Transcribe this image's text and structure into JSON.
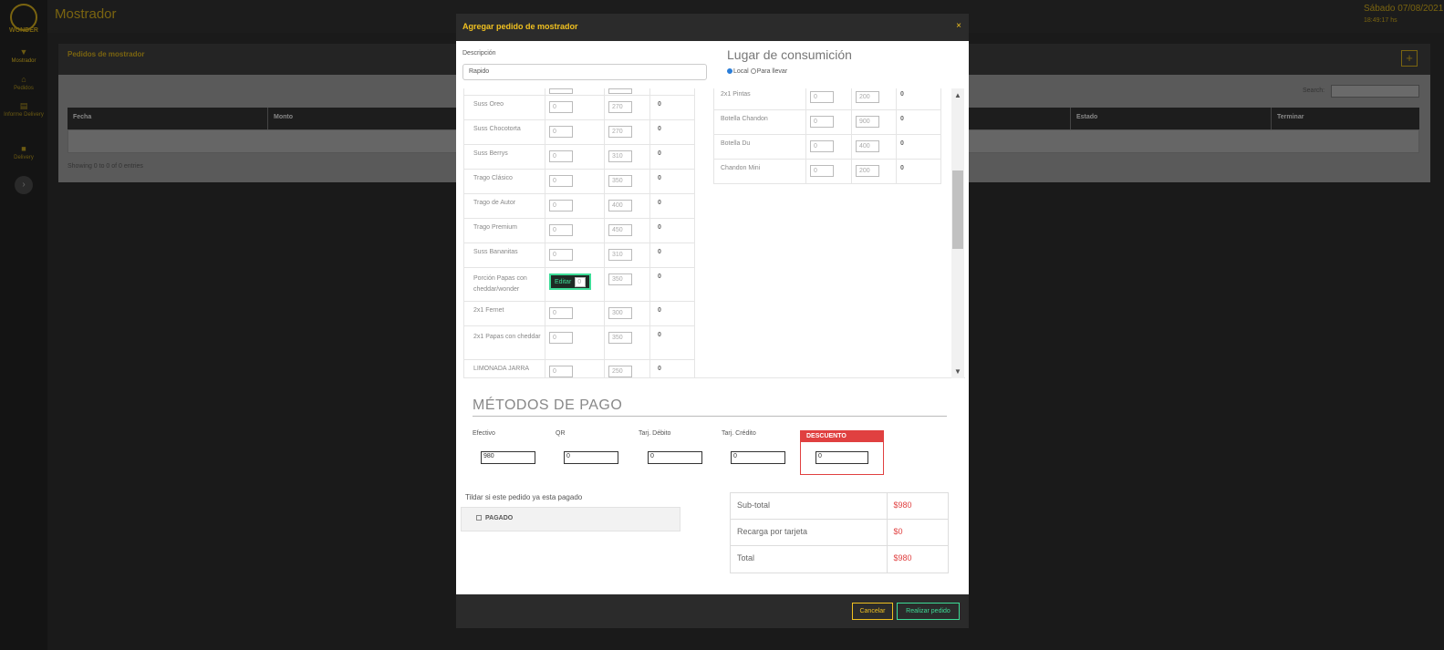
{
  "app": {
    "logo_text": "WONDER",
    "title": "Mostrador",
    "date": "Sábado 07/08/2021",
    "time": "18:49:17 hs"
  },
  "sidebar": {
    "items": [
      {
        "label": "Mostrador",
        "icon": "filter-icon"
      },
      {
        "label": "Pedidos",
        "icon": "home-icon"
      },
      {
        "label": "Informe Delivery",
        "icon": "file-icon"
      },
      {
        "label": "Delivery",
        "icon": "truck-icon"
      }
    ]
  },
  "panel": {
    "title": "Pedidos de mostrador",
    "add_label": "+",
    "search_label": "Search:",
    "columns": [
      "Fecha",
      "Monto",
      "",
      "Estado",
      "Terminar"
    ],
    "entries_text": "Showing 0 to 0 of 0 entries"
  },
  "modal": {
    "title": "Agregar pedido de mostrador",
    "close": "×",
    "description_label": "Descripción",
    "description_value": "Rapido",
    "lugar_title": "Lugar de consumición",
    "lugar_local": "Local",
    "lugar_llevar": "Para llevar",
    "left_products": [
      {
        "name": "",
        "qty": "",
        "price": "",
        "total": ""
      },
      {
        "name": "Suss Oreo",
        "qty": "0",
        "price": "270",
        "total": "0"
      },
      {
        "name": "Suss Chocotorta",
        "qty": "0",
        "price": "270",
        "total": "0"
      },
      {
        "name": "Suss Berrys",
        "qty": "0",
        "price": "310",
        "total": "0"
      },
      {
        "name": "Trago Clásico",
        "qty": "0",
        "price": "350",
        "total": "0"
      },
      {
        "name": "Trago de Autor",
        "qty": "0",
        "price": "400",
        "total": "0"
      },
      {
        "name": "Trago Premium",
        "qty": "0",
        "price": "450",
        "total": "0"
      },
      {
        "name": "Suss Bananitas",
        "qty": "0",
        "price": "310",
        "total": "0"
      },
      {
        "name": "Porción Papas con cheddar/wonder",
        "qty": "0",
        "price": "350",
        "total": "0",
        "edit": "Editar"
      },
      {
        "name": "2x1 Fernet",
        "qty": "0",
        "price": "300",
        "total": "0"
      },
      {
        "name": "2x1 Papas con cheddar",
        "qty": "0",
        "price": "350",
        "total": "0"
      },
      {
        "name": "LIMONADA JARRA",
        "qty": "0",
        "price": "250",
        "total": "0"
      }
    ],
    "right_products": [
      {
        "name": "2x1 Pintas",
        "qty": "0",
        "price": "200",
        "total": "0"
      },
      {
        "name": "Botella Chandon",
        "qty": "0",
        "price": "900",
        "total": "0"
      },
      {
        "name": "Botella Du",
        "qty": "0",
        "price": "400",
        "total": "0"
      },
      {
        "name": "Chandon Mini",
        "qty": "0",
        "price": "200",
        "total": "0"
      }
    ],
    "payment_title": "MÉTODOS DE PAGO",
    "payment_methods": [
      {
        "label": "Efectivo",
        "value": "980"
      },
      {
        "label": "QR",
        "value": "0"
      },
      {
        "label": "Tarj. Débito",
        "value": "0"
      },
      {
        "label": "Tarj. Crédito",
        "value": "0"
      }
    ],
    "discount_label": "DESCUENTO",
    "discount_value": "0",
    "paid_hint": "Tildar si este pedido ya esta pagado",
    "paid_label": "PAGADO",
    "totals": [
      {
        "label": "Sub-total",
        "value": "$980"
      },
      {
        "label": "Recarga por tarjeta",
        "value": "$0"
      },
      {
        "label": "Total",
        "value": "$980"
      }
    ],
    "cancel_label": "Cancelar",
    "submit_label": "Realizar pedido"
  },
  "colors": {
    "accent_gold": "#f0c020",
    "accent_green": "#3ddc97",
    "accent_red": "#e04040"
  }
}
